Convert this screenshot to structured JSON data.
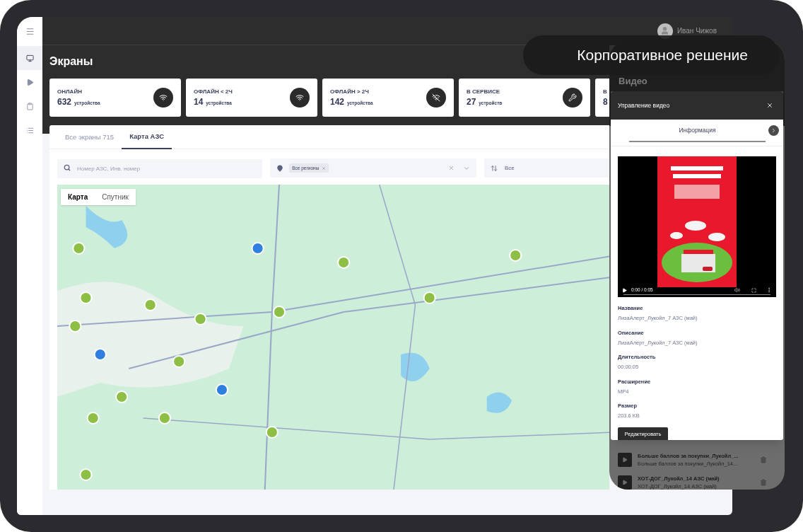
{
  "overlay_caption": "Корпоративное решение",
  "sidebar": {
    "items": [
      {
        "kind": "menu",
        "selected": false
      },
      {
        "kind": "monitor",
        "selected": true
      },
      {
        "kind": "play",
        "selected": false
      },
      {
        "kind": "clipboard",
        "selected": false
      },
      {
        "kind": "list",
        "selected": false
      }
    ]
  },
  "user": {
    "name": "Иван Чижов"
  },
  "page_title": "Экраны",
  "stat_cards": [
    {
      "title": "ОНЛАЙН",
      "count": "632",
      "unit": "устройства",
      "kind": "wifi"
    },
    {
      "title": "ОФЛАЙН < 2Ч",
      "count": "14",
      "unit": "устройства",
      "kind": "wifi"
    },
    {
      "title": "ОФЛАЙН > 2Ч",
      "count": "142",
      "unit": "устройства",
      "kind": "wifi-off"
    },
    {
      "title": "В СЕРВИСЕ",
      "count": "27",
      "unit": "устройств",
      "kind": "tools"
    },
    {
      "title": "В",
      "count": "8"
    }
  ],
  "tabs": [
    {
      "label": "Все экраны 715",
      "selected": false
    },
    {
      "label": "Карта АЗС",
      "selected": true
    }
  ],
  "filters": {
    "search": {
      "placeholder": "Номер АЗС, Инв. номер"
    },
    "region": {
      "chips": [
        "Все регионы"
      ]
    },
    "sort": {
      "value": "Все"
    }
  },
  "map": {
    "kind": "picture",
    "view_buttons": [
      {
        "label": "Карта",
        "selected": true
      },
      {
        "label": "Спутник",
        "selected": false
      }
    ]
  },
  "video_panel": {
    "title": "Видео",
    "dialog": {
      "title": "Управление видео",
      "tabs": [
        {
          "label": "Информация",
          "selected": true
        }
      ],
      "player": {
        "time": "0:00 / 0:05"
      },
      "fields": [
        {
          "label": "Название",
          "value": "ЛизаАлерт_Лукойл_7 АЗС (май)"
        },
        {
          "label": "Описание",
          "value": "ЛизаАлерт_Лукойл_7 АЗС (май)"
        },
        {
          "label": "Длительность",
          "value": "00:00:05"
        },
        {
          "label": "Расширение",
          "value": "MP4"
        },
        {
          "label": "Размер",
          "value": "203.6 KB"
        }
      ],
      "button": "Редактировать"
    },
    "list": [
      {
        "title": "Больше баллов за покупки_Лукойл_...",
        "subtitle": "Больше баллов за покупки_Лукойл_14..."
      },
      {
        "title": "ХОТ-ДОГ_Лукойл_14 АЗС (май)",
        "subtitle": "ХОТ-ДОГ_Лукойл_14 АЗС (май)"
      }
    ]
  }
}
